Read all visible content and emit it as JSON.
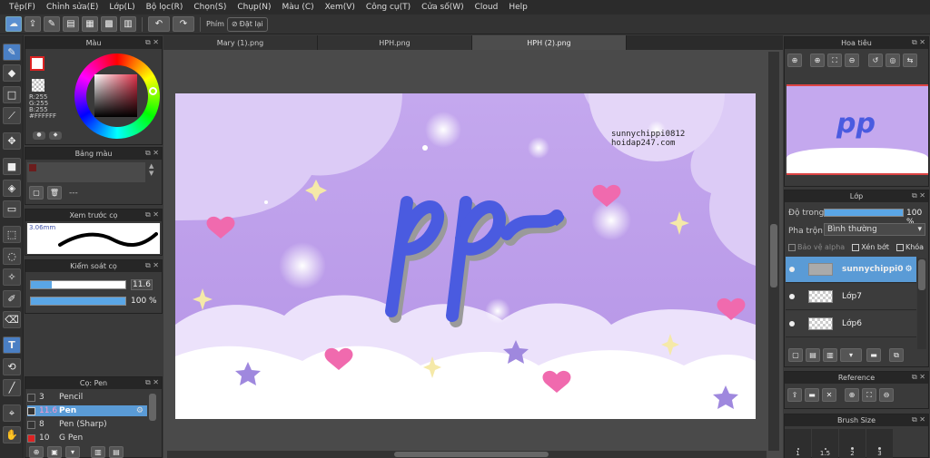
{
  "menu": [
    "Tệp(F)",
    "Chỉnh sửa(E)",
    "Lớp(L)",
    "Bộ lọc(R)",
    "Chọn(S)",
    "Chụp(N)",
    "Màu (C)",
    "Xem(V)",
    "Công cụ(T)",
    "Cửa số(W)",
    "Cloud",
    "Help"
  ],
  "toolbar": {
    "shortcut_label": "Phím",
    "reset_label": "Đặt lại"
  },
  "tabs": [
    "Mary (1).png",
    "HPH.png",
    "HPH (2).png"
  ],
  "color_panel": {
    "title": "Màu",
    "r": "R:255",
    "g": "G:255",
    "b": "B:255",
    "hex": "#FFFFFF"
  },
  "swatch_panel": {
    "title": "Bảng màu",
    "field": "---"
  },
  "brush_preview": {
    "title": "Xem trước cọ",
    "size": "3.06mm"
  },
  "brush_control": {
    "title": "Kiểm soát cọ",
    "size": "11.6",
    "opacity": "100 %",
    "size_fill": 0.22,
    "opacity_fill": 1.0
  },
  "brush_list": {
    "title": "Cọ: Pen",
    "items": [
      {
        "size": "3",
        "name": "Pencil",
        "selected": false
      },
      {
        "size": "11.6",
        "name": "Pen",
        "selected": true
      },
      {
        "size": "8",
        "name": "Pen (Sharp)",
        "selected": false
      },
      {
        "size": "10",
        "name": "G Pen",
        "selected": false
      }
    ]
  },
  "navigator": {
    "title": "Hoa tiêu"
  },
  "layers": {
    "title": "Lớp",
    "opacity_label": "Độ trong",
    "opacity": "100 %",
    "blend_label": "Pha trộn",
    "blend": "Bình thường",
    "protect": "Bảo vệ alpha",
    "clip": "Xén bớt",
    "lock": "Khóa",
    "items": [
      {
        "name": "sunnychippi0",
        "selected": true
      },
      {
        "name": "Lớp7",
        "selected": false
      },
      {
        "name": "Lớp6",
        "selected": false
      }
    ]
  },
  "reference": {
    "title": "Reference"
  },
  "brush_size": {
    "title": "Brush Size",
    "values": [
      "1",
      "1.5",
      "2",
      "3"
    ]
  },
  "artwork": {
    "watermark_1": "sunnychippi0812",
    "watermark_2": "hoidap247.com",
    "logo": "pp"
  },
  "colors": {
    "accent": "#4a8fd6",
    "primary": "#FFFFFF",
    "canvas_bg": "#c9b3ee",
    "pen_blue": "#4a5be0"
  }
}
